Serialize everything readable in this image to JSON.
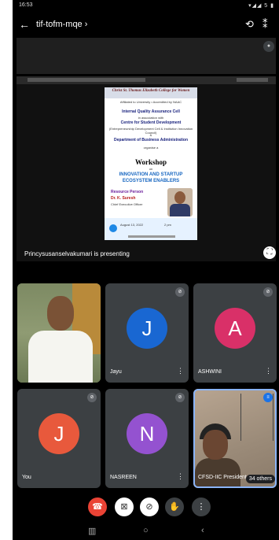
{
  "status_bar": {
    "time": "16:53",
    "right_icons": "▾◢◢ 5 ▮"
  },
  "top_bar": {
    "meeting_code": "tif-tofm-mqe ›"
  },
  "poster": {
    "college": "Christ St. Thomas Elizabeth College for Women",
    "college_sub": "Affiliated to University • Accredited by NAAC",
    "iqac": "Internal Quality Assurance Cell",
    "association": "in association with",
    "csd": "Centre for Student Development",
    "csd_sub": "(Entrepreneurship Development Cell & Institution Innovation Council)",
    "and": "&",
    "dept": "Department of Business Administration",
    "organise": "organise a",
    "workshop": "Workshop",
    "on": "on",
    "theme_line1": "INNOVATION AND STARTUP",
    "theme_line2": "ECOSYSTEM ENABLERS",
    "rp_label": "Resource Person",
    "rp_name": "Dr. K. Suresh",
    "rp_desc": "Chief Executive Officer",
    "date": "August 13, 2022",
    "time": "2 pm"
  },
  "presentation": {
    "label": "Princysusanselvakumari is presenting"
  },
  "participants": [
    {
      "name": "",
      "initial": "",
      "color": "#6d7a5a",
      "video": true
    },
    {
      "name": "Jayu",
      "initial": "J",
      "color": "#1967d2",
      "video": false
    },
    {
      "name": "ASHWINI",
      "initial": "A",
      "color": "#d93068",
      "video": false
    },
    {
      "name": "You",
      "initial": "J",
      "color": "#e8593c",
      "video": false
    },
    {
      "name": "NASREEN",
      "initial": "N",
      "color": "#9452d0",
      "video": false
    },
    {
      "name": "CFSD-IIC President",
      "initial": "",
      "color": "#8a7a69",
      "video": true
    }
  ],
  "others": {
    "label": "34 others"
  },
  "colors": {
    "end_call": "#ea4335",
    "control_bg": "#fff",
    "background": "#000"
  },
  "icons": [
    "back-arrow-icon",
    "switch-camera-icon",
    "bluetooth-icon",
    "end-call-icon",
    "camera-off-icon",
    "mic-off-icon",
    "raise-hand-icon",
    "more-options-icon"
  ]
}
